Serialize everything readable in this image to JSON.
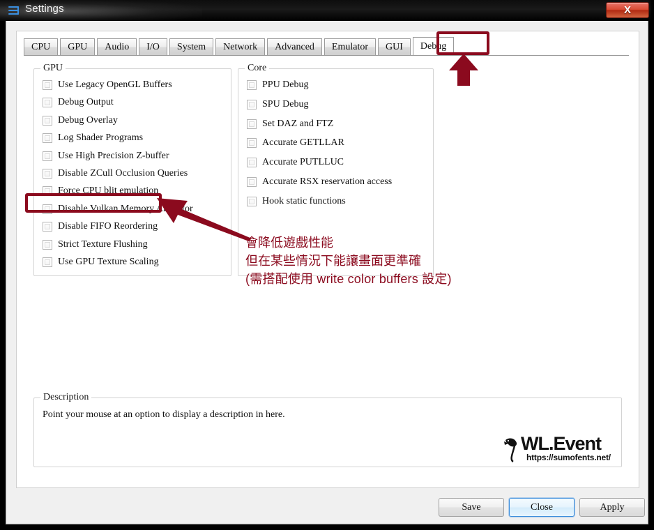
{
  "window": {
    "title": "Settings",
    "icon": "settings-menu-icon",
    "close_label": "X"
  },
  "tabs": [
    {
      "label": "CPU",
      "active": false
    },
    {
      "label": "GPU",
      "active": false
    },
    {
      "label": "Audio",
      "active": false
    },
    {
      "label": "I/O",
      "active": false
    },
    {
      "label": "System",
      "active": false
    },
    {
      "label": "Network",
      "active": false
    },
    {
      "label": "Advanced",
      "active": false
    },
    {
      "label": "Emulator",
      "active": false
    },
    {
      "label": "GUI",
      "active": false
    },
    {
      "label": "Debug",
      "active": true
    }
  ],
  "groups": {
    "gpu": {
      "title": "GPU",
      "options": [
        {
          "label": "Use Legacy OpenGL Buffers",
          "checked": false
        },
        {
          "label": "Debug Output",
          "checked": false
        },
        {
          "label": "Debug Overlay",
          "checked": false
        },
        {
          "label": "Log Shader Programs",
          "checked": false
        },
        {
          "label": "Use High Precision Z-buffer",
          "checked": false
        },
        {
          "label": "Disable ZCull Occlusion Queries",
          "checked": false
        },
        {
          "label": "Force CPU blit emulation",
          "checked": false
        },
        {
          "label": "Disable Vulkan Memory Allocator",
          "checked": false
        },
        {
          "label": "Disable FIFO Reordering",
          "checked": false
        },
        {
          "label": "Strict Texture Flushing",
          "checked": false
        },
        {
          "label": "Use GPU Texture Scaling",
          "checked": false
        }
      ]
    },
    "core": {
      "title": "Core",
      "options": [
        {
          "label": "PPU Debug",
          "checked": false
        },
        {
          "label": "SPU Debug",
          "checked": false
        },
        {
          "label": "Set DAZ and FTZ",
          "checked": false
        },
        {
          "label": "Accurate GETLLAR",
          "checked": false
        },
        {
          "label": "Accurate PUTLLUC",
          "checked": false
        },
        {
          "label": "Accurate RSX reservation access",
          "checked": false
        },
        {
          "label": "Hook static functions",
          "checked": false
        }
      ]
    }
  },
  "description": {
    "title": "Description",
    "text": "Point your mouse at an option to display a description in here."
  },
  "watermark": {
    "name": "WL.Event",
    "url": "https://sumofents.net/"
  },
  "footer": {
    "save": "Save",
    "close": "Close",
    "apply": "Apply"
  },
  "annotations": {
    "color": "#8B0A1E",
    "highlight_tab": "Debug",
    "highlight_option": "Force CPU blit emulation",
    "note_line1": "會降低遊戲性能",
    "note_line2": "但在某些情況下能讓畫面更準確",
    "note_line3": "(需搭配使用 write color buffers 設定)"
  }
}
